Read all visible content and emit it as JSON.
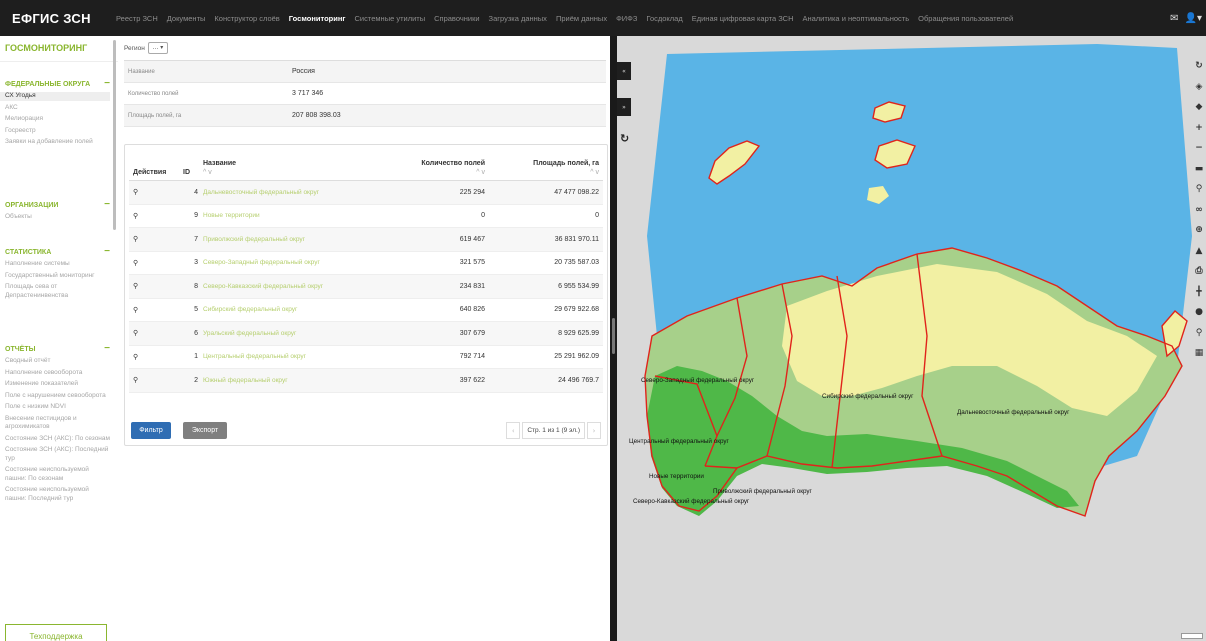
{
  "app": {
    "title": "ЕФГИС ЗСН"
  },
  "nav": {
    "items": [
      "Реестр ЗСН",
      "Документы",
      "Конструктор слоёв",
      "Госмониторинг",
      "Системные утилиты",
      "Справочники",
      "Загрузка данных",
      "Приём данных",
      "ФИФЗ",
      "Госдоклад",
      "Единая цифровая карта ЗСН",
      "Аналитика и неоптимальность",
      "Обращения пользователей"
    ],
    "active_index": 3,
    "right_icons": [
      "message-icon",
      "user-icon"
    ]
  },
  "sidebar": {
    "title": "ГОСМОНИТОРИНГ",
    "sections": [
      {
        "label": "ФЕДЕРАЛЬНЫЕ ОКРУГА",
        "items": [
          "СХ Угодья",
          "АКС",
          "Мелиорация",
          "Госреестр",
          "Заявки на добавление полей"
        ],
        "active_index": 0
      },
      {
        "label": "ОРГАНИЗАЦИИ",
        "items": [
          "Объекты"
        ]
      },
      {
        "label": "СТАТИСТИКА",
        "items": [
          "Наполнение системы",
          "Государственный мониторинг",
          "Площадь сева от Депрастенинвенства"
        ]
      },
      {
        "label": "ОТЧЁТЫ",
        "items": [
          "Сводный отчёт",
          "Наполнение севооборота",
          "Изменение показателей",
          "Поле с нарушением севооборота",
          "Поле с низким NDVI",
          "Внесение пестицидов и агрохимикатов",
          "Состояние ЗСН (АКС): По сезонам",
          "Состояние ЗСН (АКС): Последний тур",
          "Состояние неиспользуемой пашни: По сезонам",
          "Состояние неиспользуемой пашни: Последний тур"
        ]
      }
    ],
    "support_label": "Техподдержка"
  },
  "filter": {
    "region_label": "Регион",
    "region_value": "..."
  },
  "summary": [
    {
      "key": "Название",
      "value": "Россия"
    },
    {
      "key": "Количество полей",
      "value": "3 717 346"
    },
    {
      "key": "Площадь полей, га",
      "value": "207 808 398.03"
    }
  ],
  "table": {
    "columns": [
      "Действия",
      "ID",
      "Название",
      "Количество полей",
      "Площадь полей, га"
    ],
    "sort_glyph": "^ v",
    "rows": [
      {
        "id": "4",
        "name": "Дальневосточный федеральный округ",
        "fields": "225 294",
        "area": "47 477 098.22"
      },
      {
        "id": "9",
        "name": "Новые территории",
        "fields": "0",
        "area": "0"
      },
      {
        "id": "7",
        "name": "Приволжский федеральный округ",
        "fields": "619 467",
        "area": "36 831 970.11"
      },
      {
        "id": "3",
        "name": "Северо-Западный федеральный округ",
        "fields": "321 575",
        "area": "20 735 587.03"
      },
      {
        "id": "8",
        "name": "Северо-Кавказский федеральный округ",
        "fields": "234 831",
        "area": "6 955 534.99"
      },
      {
        "id": "5",
        "name": "Сибирский федеральный округ",
        "fields": "640 826",
        "area": "29 679 922.68"
      },
      {
        "id": "6",
        "name": "Уральский федеральный округ",
        "fields": "307 679",
        "area": "8 929 625.99"
      },
      {
        "id": "1",
        "name": "Центральный федеральный округ",
        "fields": "792 714",
        "area": "25 291 962.09"
      },
      {
        "id": "2",
        "name": "Южный федеральный округ",
        "fields": "397 622",
        "area": "24 496 769.7"
      }
    ],
    "filter_label": "Фильтр",
    "export_label": "Экспорт",
    "page_info": "Стр. 1 из 1 (9 эл.)",
    "prev_glyph": "‹",
    "next_glyph": "›"
  },
  "map": {
    "labels": [
      "Северо-Западный федеральный округ",
      "Сибирский федеральный округ",
      "Дальневосточный федеральный округ",
      "Центральный федеральный округ",
      "Новые территории",
      "Приволжский федеральный округ",
      "Северо-Кавказский федеральный округ"
    ],
    "colors": {
      "sea": "#5ab4e6",
      "land_bg": "#d9d9d9",
      "border": "#e0241b",
      "agro": "#4fb848",
      "tundra": "#f2f0a3",
      "forest": "#a7d08a"
    },
    "toolbar_icons": [
      "refresh-icon",
      "layers-icon",
      "layer-stack-icon",
      "zoom-in-icon",
      "zoom-out-icon",
      "ruler-icon",
      "marker-icon",
      "measure-icon",
      "zoom-extent-icon",
      "split-icon",
      "print-icon",
      "tree-icon",
      "pin-icon",
      "search-icon",
      "table-icon"
    ]
  }
}
